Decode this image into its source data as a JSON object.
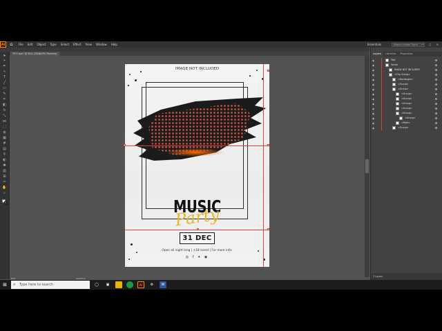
{
  "app": {
    "logo": "Ai",
    "menus": [
      "File",
      "Edit",
      "Object",
      "Type",
      "Select",
      "Effect",
      "View",
      "Window",
      "Help"
    ],
    "workspace": "Essentials",
    "search_placeholder": "Search Adobe Stock",
    "window_controls": "— ◻ ✕"
  },
  "document_tab": {
    "label": "TFI7.eps* @ 80% (RGB/GPU Preview)"
  },
  "toolbar": {
    "tools": [
      "select-tool",
      "direct-select-tool",
      "pen-tool",
      "curvature-tool",
      "type-tool",
      "line-tool",
      "rectangle-tool",
      "paintbrush-tool",
      "pencil-tool",
      "eraser-tool",
      "rotate-tool",
      "scale-tool",
      "width-tool",
      "free-transform-tool",
      "shape-builder-tool",
      "perspective-tool",
      "mesh-tool",
      "gradient-tool",
      "eyedropper-tool",
      "blend-tool",
      "symbol-sprayer-tool",
      "graph-tool",
      "artboard-tool",
      "slice-tool",
      "hand-tool",
      "zoom-tool"
    ]
  },
  "poster": {
    "image_note": "IMAGE NOT INCLUDED",
    "title": "MUSIC",
    "subtitle": "Party",
    "date": "31 DEC",
    "info": "Open all night long  |  +18 event  |  For more info:",
    "socials": "◎ f ✦ ◉"
  },
  "layers_panel": {
    "tabs": [
      "Layers",
      "Libraries",
      "Properties"
    ],
    "active_tab": "Layers",
    "rows": [
      {
        "name": "Text",
        "indent": 0
      },
      {
        "name": "Vector",
        "indent": 0
      },
      {
        "name": "IMAGE NOT INCLUDED",
        "indent": 1
      },
      {
        "name": "<Clip Group>",
        "indent": 1
      },
      {
        "name": "<Rectangle>",
        "indent": 2
      },
      {
        "name": "<Group>",
        "indent": 2
      },
      {
        "name": "<Group>",
        "indent": 2
      },
      {
        "name": "<Group>",
        "indent": 3
      },
      {
        "name": "<Group>",
        "indent": 3
      },
      {
        "name": "<Group>",
        "indent": 3
      },
      {
        "name": "<Group>",
        "indent": 3
      },
      {
        "name": "<Group>",
        "indent": 3
      },
      {
        "name": "<Group>",
        "indent": 4
      },
      {
        "name": "<Path>",
        "indent": 3
      },
      {
        "name": "<Group>",
        "indent": 2
      }
    ],
    "footer": "2 Layers"
  },
  "status": {
    "zoom": "80%",
    "selection": "Selection"
  },
  "taskbar": {
    "search_placeholder": "Type here to search"
  },
  "colors": {
    "accent": "#e04040",
    "gold": "#f0b320",
    "brush": "#1b1b1b"
  }
}
